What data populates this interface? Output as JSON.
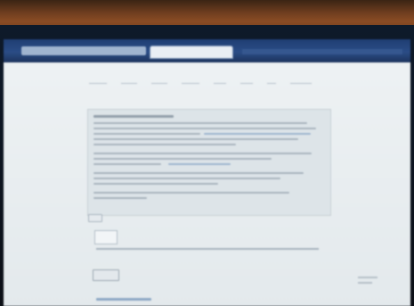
{
  "browser": {
    "tab_label": "",
    "address": ""
  },
  "site": {
    "logo": "",
    "nav": []
  },
  "content": {
    "heading": "",
    "lines": []
  },
  "form": {
    "submit_label": ""
  }
}
